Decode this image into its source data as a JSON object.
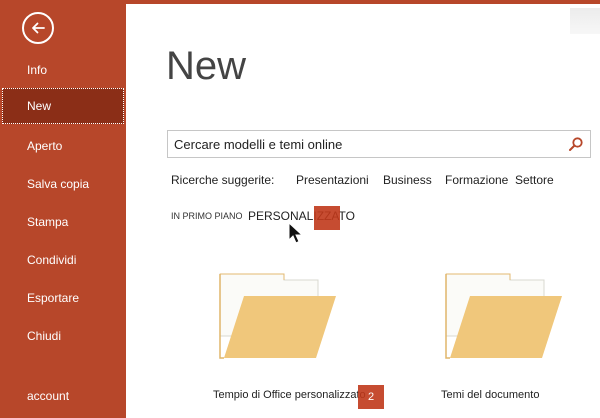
{
  "sidebar": {
    "items": [
      {
        "label": "Info",
        "selected": false
      },
      {
        "label": "New",
        "selected": true
      },
      {
        "label": "Aperto",
        "selected": false
      },
      {
        "label": "Salva copia",
        "selected": false
      },
      {
        "label": "Stampa",
        "selected": false
      },
      {
        "label": "Condividi",
        "selected": false
      },
      {
        "label": "Esportare",
        "selected": false
      },
      {
        "label": "Chiudi",
        "selected": false
      },
      {
        "label": "account",
        "selected": false
      }
    ]
  },
  "main": {
    "title": "New",
    "search": {
      "placeholder": "Cercare modelli e temi online"
    },
    "suggested": {
      "label": "Ricerche suggerite:",
      "links": [
        "Presentazioni",
        "Business",
        "Formazione",
        "Settore"
      ]
    },
    "filters": [
      {
        "label": "IN PRIMO PIANO",
        "active": false
      },
      {
        "label": "PERSONALIZZATO",
        "active": true
      }
    ],
    "tiles": [
      {
        "label": "Tempio di Office personalizzato"
      },
      {
        "label": "Temi del documento"
      }
    ],
    "callouts": [
      "",
      "2"
    ]
  },
  "colors": {
    "sidebar": "#b7472a",
    "sidebar_selected": "#8b2e17",
    "folder": "#f0c77b",
    "callout": "#c0391b"
  },
  "icons": {
    "back": "back-arrow-icon",
    "search": "search-icon",
    "folder": "folder-icon"
  }
}
